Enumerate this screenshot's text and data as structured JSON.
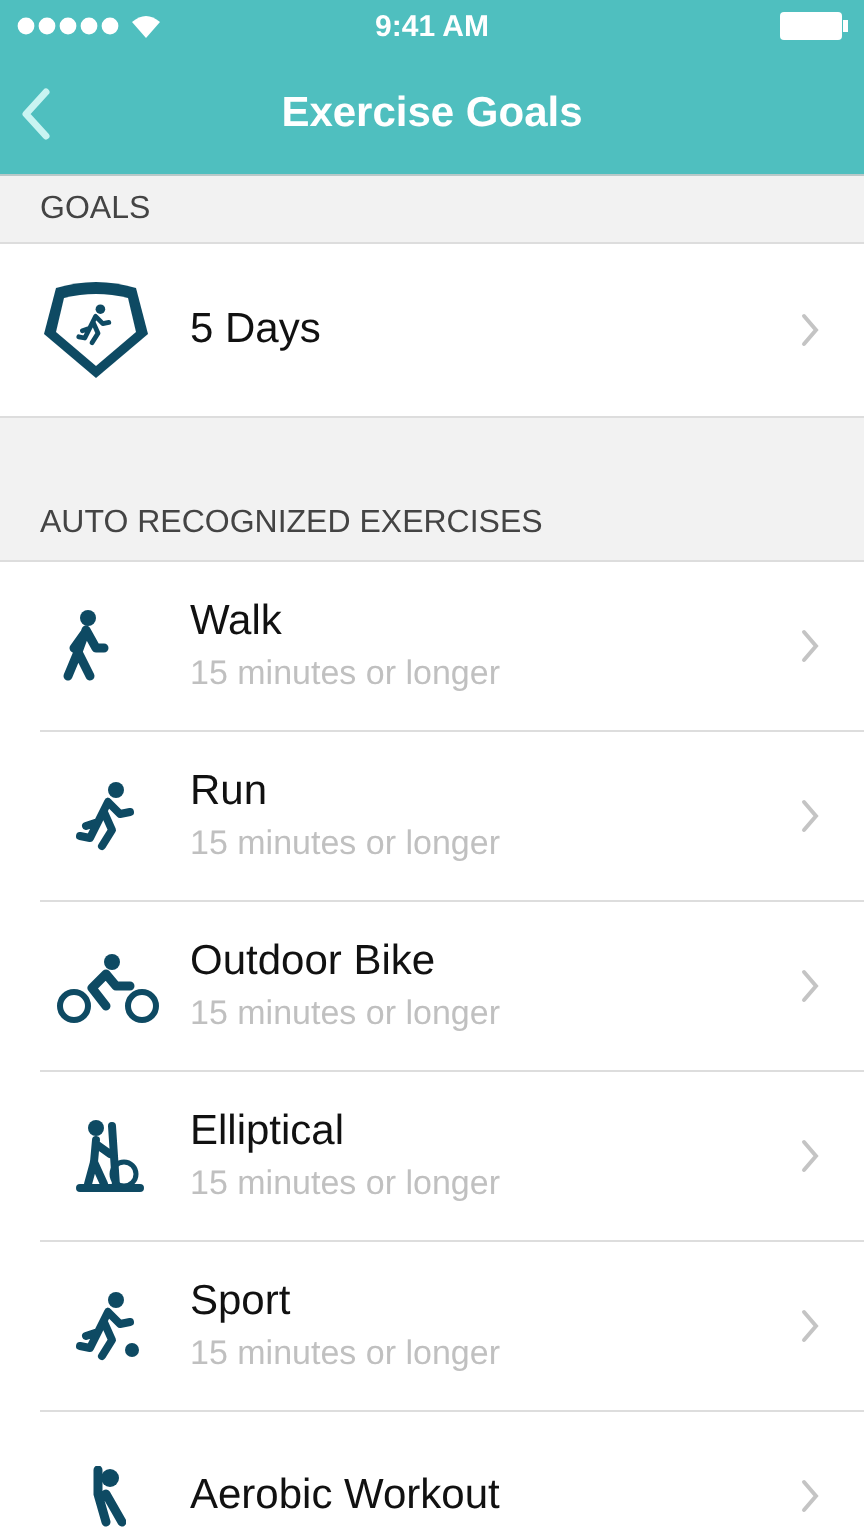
{
  "status_bar": {
    "time": "9:41 AM"
  },
  "nav": {
    "title": "Exercise Goals"
  },
  "goals_section": {
    "header": "GOALS",
    "item": {
      "label": "5 Days"
    }
  },
  "exercises_section": {
    "header": "AUTO RECOGNIZED EXERCISES",
    "items": [
      {
        "kind": "walk",
        "name": "Walk",
        "subtitle": "15 minutes or longer"
      },
      {
        "kind": "run",
        "name": "Run",
        "subtitle": "15 minutes or longer"
      },
      {
        "kind": "bike",
        "name": "Outdoor Bike",
        "subtitle": "15 minutes or longer"
      },
      {
        "kind": "elliptical",
        "name": "Elliptical",
        "subtitle": "15 minutes or longer"
      },
      {
        "kind": "sport",
        "name": "Sport",
        "subtitle": "15 minutes or longer"
      },
      {
        "kind": "aerobic",
        "name": "Aerobic Workout"
      }
    ]
  }
}
